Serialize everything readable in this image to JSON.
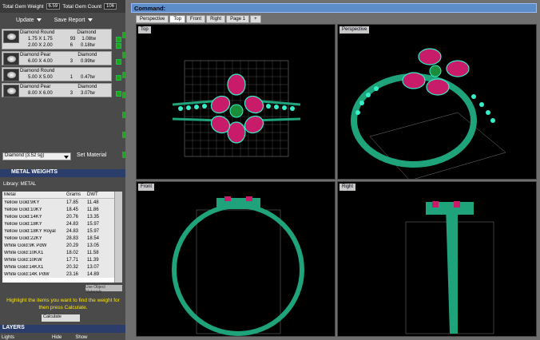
{
  "gem_header": {
    "weight_label": "Total Gem Weight",
    "weight_value": "6.59",
    "count_label": "Total Gem Count",
    "count_value": "106"
  },
  "actions": {
    "update": "Update",
    "save_report": "Save Report"
  },
  "gem_groups": [
    {
      "title": "Diamond Round",
      "type": "Diamond",
      "lines": [
        [
          "1.75 X 1.75",
          "93",
          "1.08tw"
        ],
        [
          "2.00 X 2.00",
          "6",
          "0.18tw"
        ]
      ]
    },
    {
      "title": "Diamond Pear",
      "type": "Diamond",
      "lines": [
        [
          "6.00 X 4.00",
          "3",
          "0.99tw"
        ]
      ]
    },
    {
      "title": "Diamond Round",
      "type": "",
      "lines": [
        [
          "5.00 X 5.00",
          "1",
          "0.47tw"
        ]
      ]
    },
    {
      "title": "Diamond Pear",
      "type": "Diamond",
      "lines": [
        [
          "8.00 X 6.00",
          "3",
          "3.07tw"
        ]
      ]
    }
  ],
  "material": {
    "select": "Diamond   (3.52 sg)",
    "set_label": "Set Material"
  },
  "metal_weights": {
    "title": "METAL WEIGHTS",
    "library": "Library: METAL",
    "cols": [
      "Metal",
      "Grams",
      "DWT"
    ],
    "rows": [
      [
        "Yellow Gold:9KY",
        "17.85",
        "11.48"
      ],
      [
        "Yellow Gold:10KY",
        "18.45",
        "11.86"
      ],
      [
        "Yellow Gold:14KY",
        "20.76",
        "13.35"
      ],
      [
        "Yellow Gold:18KY",
        "24.83",
        "15.97"
      ],
      [
        "Yellow Gold:18KY Royal",
        "24.83",
        "15.97"
      ],
      [
        "Yellow Gold:22KY",
        "28.83",
        "18.54"
      ],
      [
        "White Gold:9K PdW",
        "20.29",
        "13.05"
      ],
      [
        "White Gold:10KX1",
        "18.02",
        "11.58"
      ],
      [
        "White Gold:10KW",
        "17.71",
        "11.39"
      ],
      [
        "White Gold:14KX1",
        "20.32",
        "13.07"
      ],
      [
        "White Gold:14K PdW",
        "23.16",
        "14.89"
      ]
    ],
    "use_obj": "Use Object Materials",
    "hint": "Highlight the items you want to find the weight for then press Calculate.",
    "calculate": "Calculate"
  },
  "layers": {
    "title": "LAYERS",
    "lights": "Lights",
    "hide": "Hide",
    "show": "Show"
  },
  "command": "Command:",
  "tabs": [
    "Perspective",
    "Top",
    "Front",
    "Right",
    "Page 1",
    "+"
  ],
  "viewports": {
    "top": "Top",
    "perspective": "Perspective",
    "front": "Front",
    "right": "Right"
  },
  "colors": {
    "metal": "#1fa37a",
    "diamond": "#35f0c8",
    "ruby": "#c81c6a",
    "emerald": "#1a8c3a",
    "grid": "#7a7a7a"
  }
}
